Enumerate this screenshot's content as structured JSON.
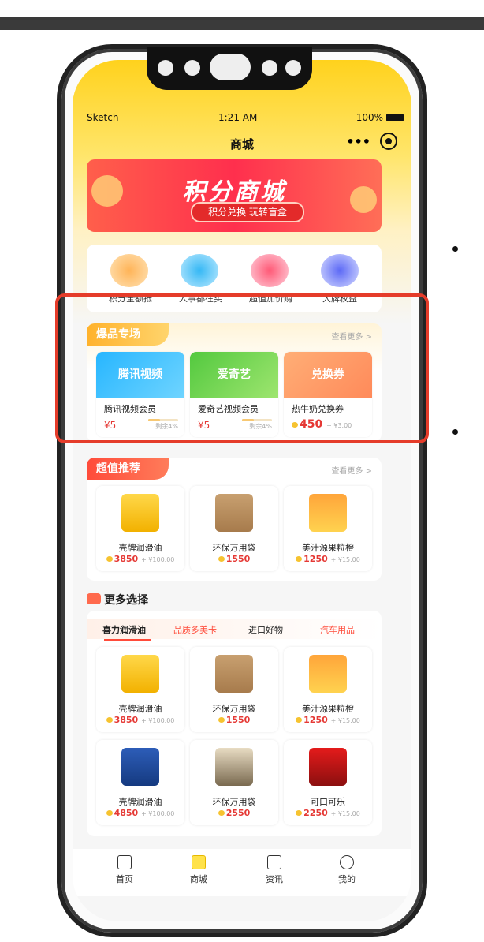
{
  "status": {
    "carrier": "Sketch",
    "time": "1:21 AM",
    "battery": "100%"
  },
  "nav": {
    "title": "商城",
    "more": "•••"
  },
  "banner": {
    "title": "积分商城",
    "subtitle": "积分兑换 玩转盲盒"
  },
  "categories": [
    "积分全额抵",
    "人事都在买",
    "超值加价购",
    "大牌权益"
  ],
  "hot": {
    "tag": "爆品专场",
    "more": "查看更多 >",
    "items": [
      {
        "logo": "腾讯视频",
        "name": "腾讯视频会员",
        "price": "¥5",
        "remain": "剩余4%",
        "remain_fraction": 0.04
      },
      {
        "logo": "爱奇艺",
        "name": "爱奇艺视频会员",
        "price": "¥5",
        "remain": "剩余4%",
        "remain_fraction": 0.04
      },
      {
        "logo": "兑换券",
        "name": "热牛奶兑换券",
        "price": "450",
        "price_extra": "+ ¥3.00"
      }
    ]
  },
  "recommend": {
    "tag": "超值推荐",
    "more": "查看更多 >",
    "items": [
      {
        "name": "壳牌润滑油",
        "price": "3850",
        "extra": "+ ¥100.00"
      },
      {
        "name": "环保万用袋",
        "price": "1550",
        "extra": ""
      },
      {
        "name": "美汁源果粒橙",
        "price": "1250",
        "extra": "+ ¥15.00"
      }
    ]
  },
  "more_section": {
    "title": "更多选择",
    "tabs": [
      "喜力润滑油",
      "品质多美卡",
      "进口好物",
      "汽车用品"
    ],
    "items": [
      {
        "name": "壳牌润滑油",
        "price": "3850",
        "extra": "+ ¥100.00"
      },
      {
        "name": "环保万用袋",
        "price": "1550",
        "extra": ""
      },
      {
        "name": "美汁源果粒橙",
        "price": "1250",
        "extra": "+ ¥15.00"
      },
      {
        "name": "壳牌润滑油",
        "price": "4850",
        "extra": "+ ¥100.00"
      },
      {
        "name": "环保万用袋",
        "price": "2550",
        "extra": ""
      },
      {
        "name": "可口可乐",
        "price": "2250",
        "extra": "+ ¥15.00"
      }
    ]
  },
  "tabbar": [
    {
      "label": "首页",
      "icon": "home-icon"
    },
    {
      "label": "商城",
      "icon": "shop-icon"
    },
    {
      "label": "资讯",
      "icon": "news-icon"
    },
    {
      "label": "我的",
      "icon": "user-icon"
    }
  ],
  "colors": {
    "accent": "#ffd21d",
    "brand_red": "#ff4b3a",
    "highlight": "#e53c2a"
  }
}
